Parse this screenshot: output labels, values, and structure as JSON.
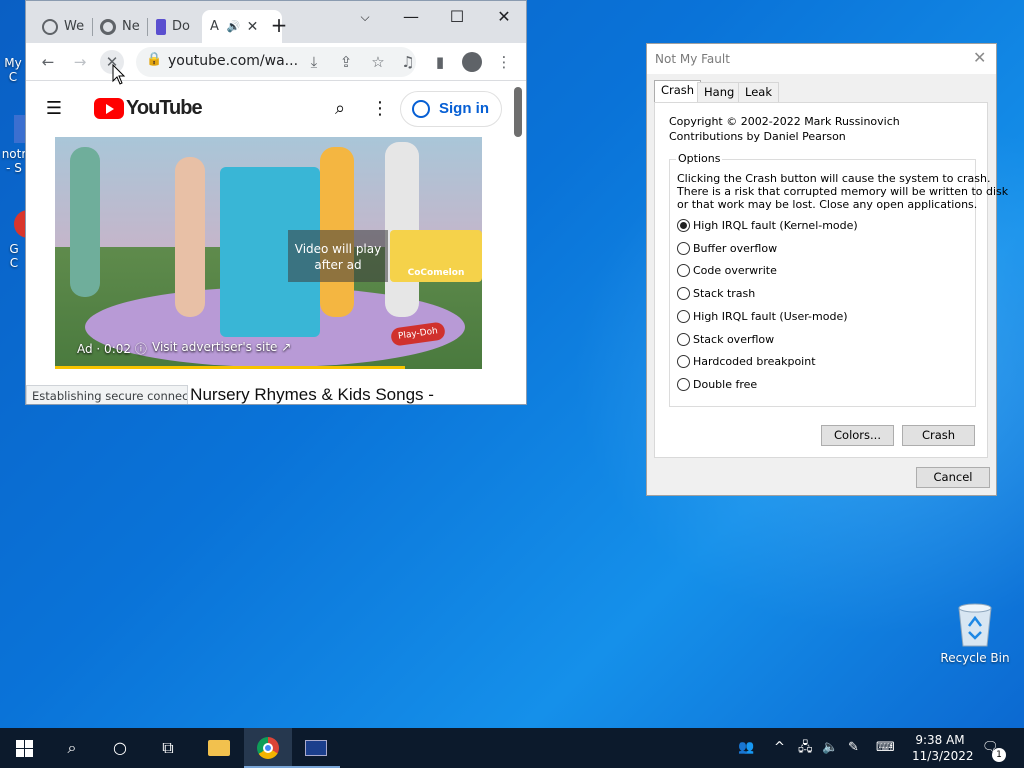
{
  "desktop": {
    "icons": [
      {
        "label": "My C"
      },
      {
        "label": "notr"
      },
      {
        "label": "- S"
      },
      {
        "label": "G"
      },
      {
        "label": "C"
      }
    ],
    "recycle_bin": "Recycle Bin"
  },
  "chrome": {
    "tabs": [
      {
        "label": "We"
      },
      {
        "label": "Ne"
      },
      {
        "label": "Do"
      },
      {
        "label": "A"
      }
    ],
    "new_tab": "+",
    "url": "youtube.com/wa...",
    "status": "Establishing secure connec...",
    "youtube": {
      "logo_text": "YouTube",
      "sign_in": "Sign in",
      "video": {
        "overlay": "Video will play after ad",
        "ad_time": "Ad · 0:02",
        "visit": "Visit advertiser's site",
        "brand": "Play-Doh",
        "channel_badge": "CoComelon"
      },
      "title": "e Nursery Rhymes & Kids Songs -"
    }
  },
  "dialog": {
    "title": "Not My Fault",
    "tabs": [
      "Crash",
      "Hang",
      "Leak"
    ],
    "active_tab": "Crash",
    "copyright": "Copyright © 2002-2022 Mark Russinovich",
    "contrib": "Contributions by Daniel Pearson",
    "options_label": "Options",
    "warning": [
      "Clicking the Crash button will cause the system to crash.",
      "There is a risk that corrupted memory will be written to disk",
      "or that work may be lost. Close any open applications."
    ],
    "options": [
      {
        "label": "High IRQL fault (Kernel-mode)",
        "selected": true
      },
      {
        "label": "Buffer overflow"
      },
      {
        "label": "Code overwrite"
      },
      {
        "label": "Stack trash"
      },
      {
        "label": "High IRQL fault (User-mode)"
      },
      {
        "label": "Stack overflow"
      },
      {
        "label": "Hardcoded breakpoint"
      },
      {
        "label": "Double free"
      }
    ],
    "colors_btn": "Colors...",
    "crash_btn": "Crash",
    "cancel_btn": "Cancel"
  },
  "taskbar": {
    "time": "9:38 AM",
    "date": "11/3/2022",
    "notifications": "1"
  },
  "colors": {
    "accent": "#065fd4",
    "taskbar": "#0c1a2c",
    "desktop": "#0a73d8"
  }
}
